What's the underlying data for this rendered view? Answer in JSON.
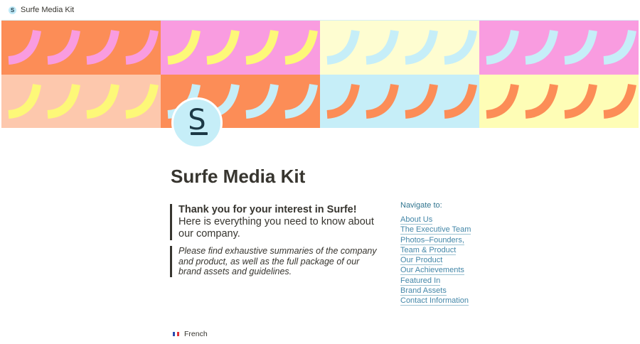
{
  "topbar": {
    "favicon_letter": "S",
    "title": "Surfe Media Kit"
  },
  "cover": {
    "rows": [
      [
        {
          "bg": "#fc8d57",
          "wave": "#f99ce0"
        },
        {
          "bg": "#f99ce0",
          "wave": "#fdf878"
        },
        {
          "bg": "#fefdd1",
          "wave": "#c6eef8"
        },
        {
          "bg": "#f99ce0",
          "wave": "#c6eef8"
        }
      ],
      [
        {
          "bg": "#fdc8ad",
          "wave": "#fdf878"
        },
        {
          "bg": "#fc8d57",
          "wave": "#c6eef8"
        },
        {
          "bg": "#c6eef8",
          "wave": "#fc8d57"
        },
        {
          "bg": "#fefdb6",
          "wave": "#fc8d57"
        }
      ]
    ]
  },
  "avatar": {
    "letter": "S"
  },
  "page": {
    "title": "Surfe Media Kit",
    "intro_bold": "Thank you for your interest in Surfe!",
    "intro_text": "Here is everything you need to know about our company.",
    "summary": "Please find exhaustive summaries of the company and product, as well as the full package of our brand assets and guidelines."
  },
  "nav": {
    "heading": "Navigate to:",
    "links": [
      "About Us",
      "The Executive Team",
      "Photos–Founders,",
      "Team & Product",
      "Our Product",
      "Our Achievements",
      "Featured In",
      "Brand Assets",
      "Contact Information"
    ]
  },
  "language": {
    "label": "French",
    "flag_colors": [
      "#2b4bb0",
      "#ffffff",
      "#e0323b"
    ]
  }
}
